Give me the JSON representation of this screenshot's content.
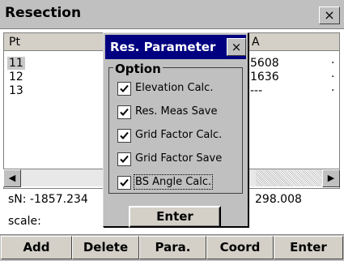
{
  "window": {
    "title": "Resection",
    "close_glyph": "×"
  },
  "list": {
    "columns": [
      "Pt",
      "A"
    ],
    "rows": [
      {
        "pt": "11",
        "a": "5608",
        "selected": true
      },
      {
        "pt": "12",
        "a": "1636",
        "selected": false
      },
      {
        "pt": "13",
        "a": "---",
        "selected": false
      }
    ],
    "trailing_marks": [
      "·",
      "·",
      "·"
    ]
  },
  "status": {
    "sn": "sN: -1857.234",
    "right": "298.008",
    "scale_label": "scale:"
  },
  "toolbar": {
    "add": "Add",
    "delete": "Delete",
    "para": "Para.",
    "coord": "Coord",
    "enter": "Enter"
  },
  "dialog": {
    "title": "Res. Parameter",
    "close_glyph": "×",
    "group_label": "Option",
    "options": [
      {
        "label": "Elevation Calc.",
        "checked": true
      },
      {
        "label": "Res. Meas Save",
        "checked": true
      },
      {
        "label": "Grid Factor Calc.",
        "checked": true
      },
      {
        "label": "Grid Factor Save",
        "checked": true
      },
      {
        "label": "BS Angle Calc.",
        "checked": true
      }
    ],
    "enter_label": "Enter"
  },
  "icons": {
    "scroll_left": "scroll-left-arrow-icon",
    "scroll_right": "scroll-right-arrow-icon",
    "checkmark": "checkmark-icon"
  }
}
